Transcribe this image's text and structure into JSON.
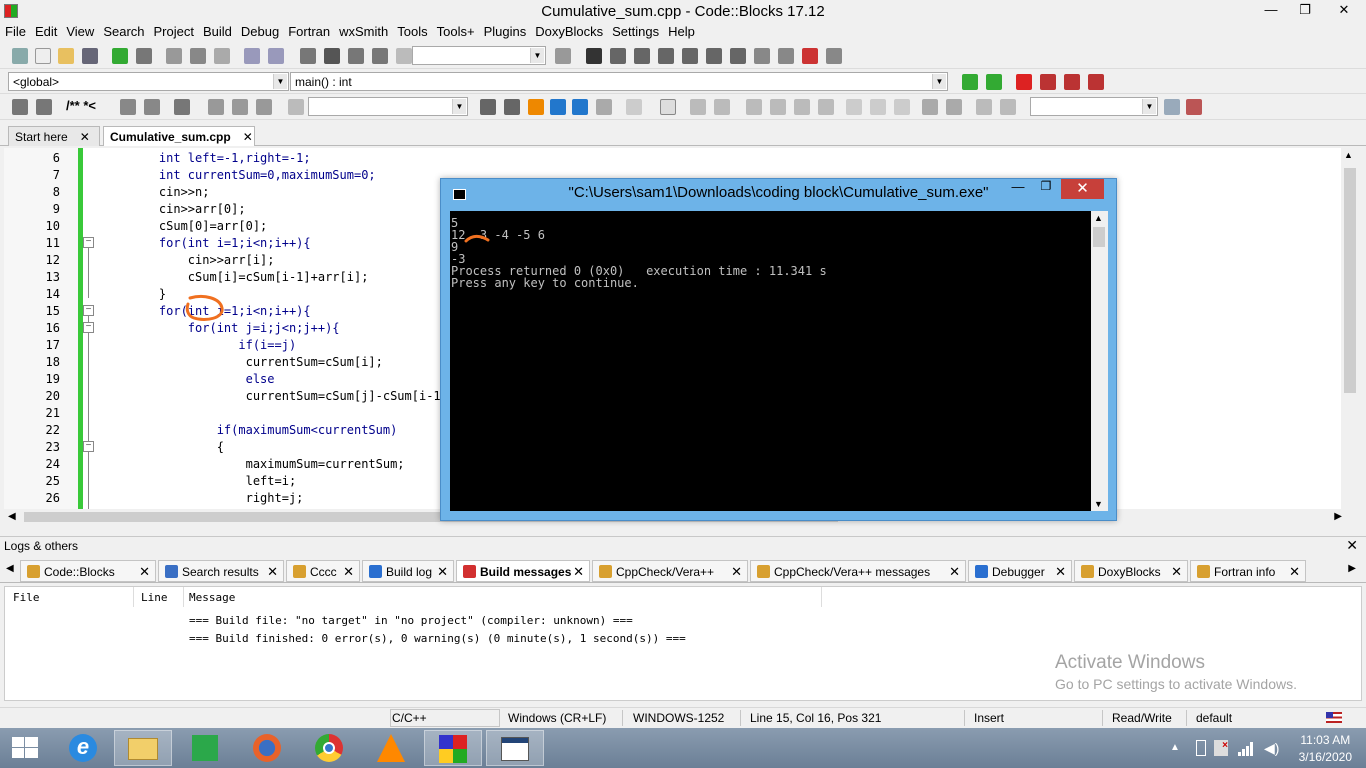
{
  "window": {
    "title": "Cumulative_sum.cpp - Code::Blocks 17.12",
    "minimize": "—",
    "maximize": "❐",
    "close": "✕"
  },
  "menu": [
    "File",
    "Edit",
    "View",
    "Search",
    "Project",
    "Build",
    "Debug",
    "Fortran",
    "wxSmith",
    "Tools",
    "Tools+",
    "Plugins",
    "DoxyBlocks",
    "Settings",
    "Help"
  ],
  "toolbar": {
    "scope_combo": "<global>",
    "function_combo": "main() : int"
  },
  "editor_tabs": [
    {
      "label": "Start here",
      "close": "✕"
    },
    {
      "label": "Cumulative_sum.cpp",
      "close": "✕"
    }
  ],
  "code_lines": [
    {
      "n": "6",
      "text": "    int left=-1,right=-1;"
    },
    {
      "n": "7",
      "text": "    int currentSum=0,maximumSum=0;"
    },
    {
      "n": "8",
      "text": "    cin>>n;"
    },
    {
      "n": "9",
      "text": "    cin>>arr[0];"
    },
    {
      "n": "10",
      "text": "    cSum[0]=arr[0];"
    },
    {
      "n": "11",
      "text": "    for(int i=1;i<n;i++){"
    },
    {
      "n": "12",
      "text": "        cin>>arr[i];"
    },
    {
      "n": "13",
      "text": "        cSum[i]=cSum[i-1]+arr[i];"
    },
    {
      "n": "14",
      "text": "    }"
    },
    {
      "n": "15",
      "text": "    for(int i=1;i<n;i++){"
    },
    {
      "n": "16",
      "text": "        for(int j=i;j<n;j++){"
    },
    {
      "n": "17",
      "text": "               if(i==j)"
    },
    {
      "n": "18",
      "text": "                currentSum=cSum[i];"
    },
    {
      "n": "19",
      "text": "                else"
    },
    {
      "n": "20",
      "text": "                currentSum=cSum[j]-cSum[i-1"
    },
    {
      "n": "21",
      "text": ""
    },
    {
      "n": "22",
      "text": "            if(maximumSum<currentSum)"
    },
    {
      "n": "23",
      "text": "            {"
    },
    {
      "n": "24",
      "text": "                maximumSum=currentSum;"
    },
    {
      "n": "25",
      "text": "                left=i;"
    },
    {
      "n": "26",
      "text": "                right=j;"
    }
  ],
  "console": {
    "title": "\"C:\\Users\\sam1\\Downloads\\coding block\\Cumulative_sum.exe\"",
    "lines": [
      "5",
      "12 -3 -4 -5 6",
      "9",
      "-3",
      "Process returned 0 (0x0)   execution time : 11.341 s",
      "Press any key to continue."
    ]
  },
  "logs": {
    "header": "Logs & others",
    "close": "✕",
    "tabs": [
      {
        "label": "Code::Blocks",
        "color": "#d8a030"
      },
      {
        "label": "Search results",
        "color": "#3a6fc4"
      },
      {
        "label": "Cccc",
        "color": "#d8a030"
      },
      {
        "label": "Build log",
        "color": "#2a6fd0"
      },
      {
        "label": "Build messages",
        "color": "#d23030"
      },
      {
        "label": "CppCheck/Vera++",
        "color": "#d8a030"
      },
      {
        "label": "CppCheck/Vera++ messages",
        "color": "#d8a030"
      },
      {
        "label": "Debugger",
        "color": "#2a6fd0"
      },
      {
        "label": "DoxyBlocks",
        "color": "#d8a030"
      },
      {
        "label": "Fortran info",
        "color": "#d8a030"
      }
    ],
    "columns": [
      "File",
      "Line",
      "Message"
    ],
    "messages": [
      "=== Build file: \"no target\" in \"no project\" (compiler: unknown) ===",
      "=== Build finished: 0 error(s), 0 warning(s) (0 minute(s), 1 second(s)) ==="
    ]
  },
  "watermark": {
    "line1": "Activate Windows",
    "line2": "Go to PC settings to activate Windows."
  },
  "status": {
    "language": "C/C++",
    "eol": "Windows (CR+LF)",
    "encoding": "WINDOWS-1252",
    "position": "Line 15, Col 16, Pos 321",
    "mode": "Insert",
    "access": "Read/Write",
    "profile": "default"
  },
  "taskbar": {
    "time": "11:03 AM",
    "date": "3/16/2020"
  }
}
